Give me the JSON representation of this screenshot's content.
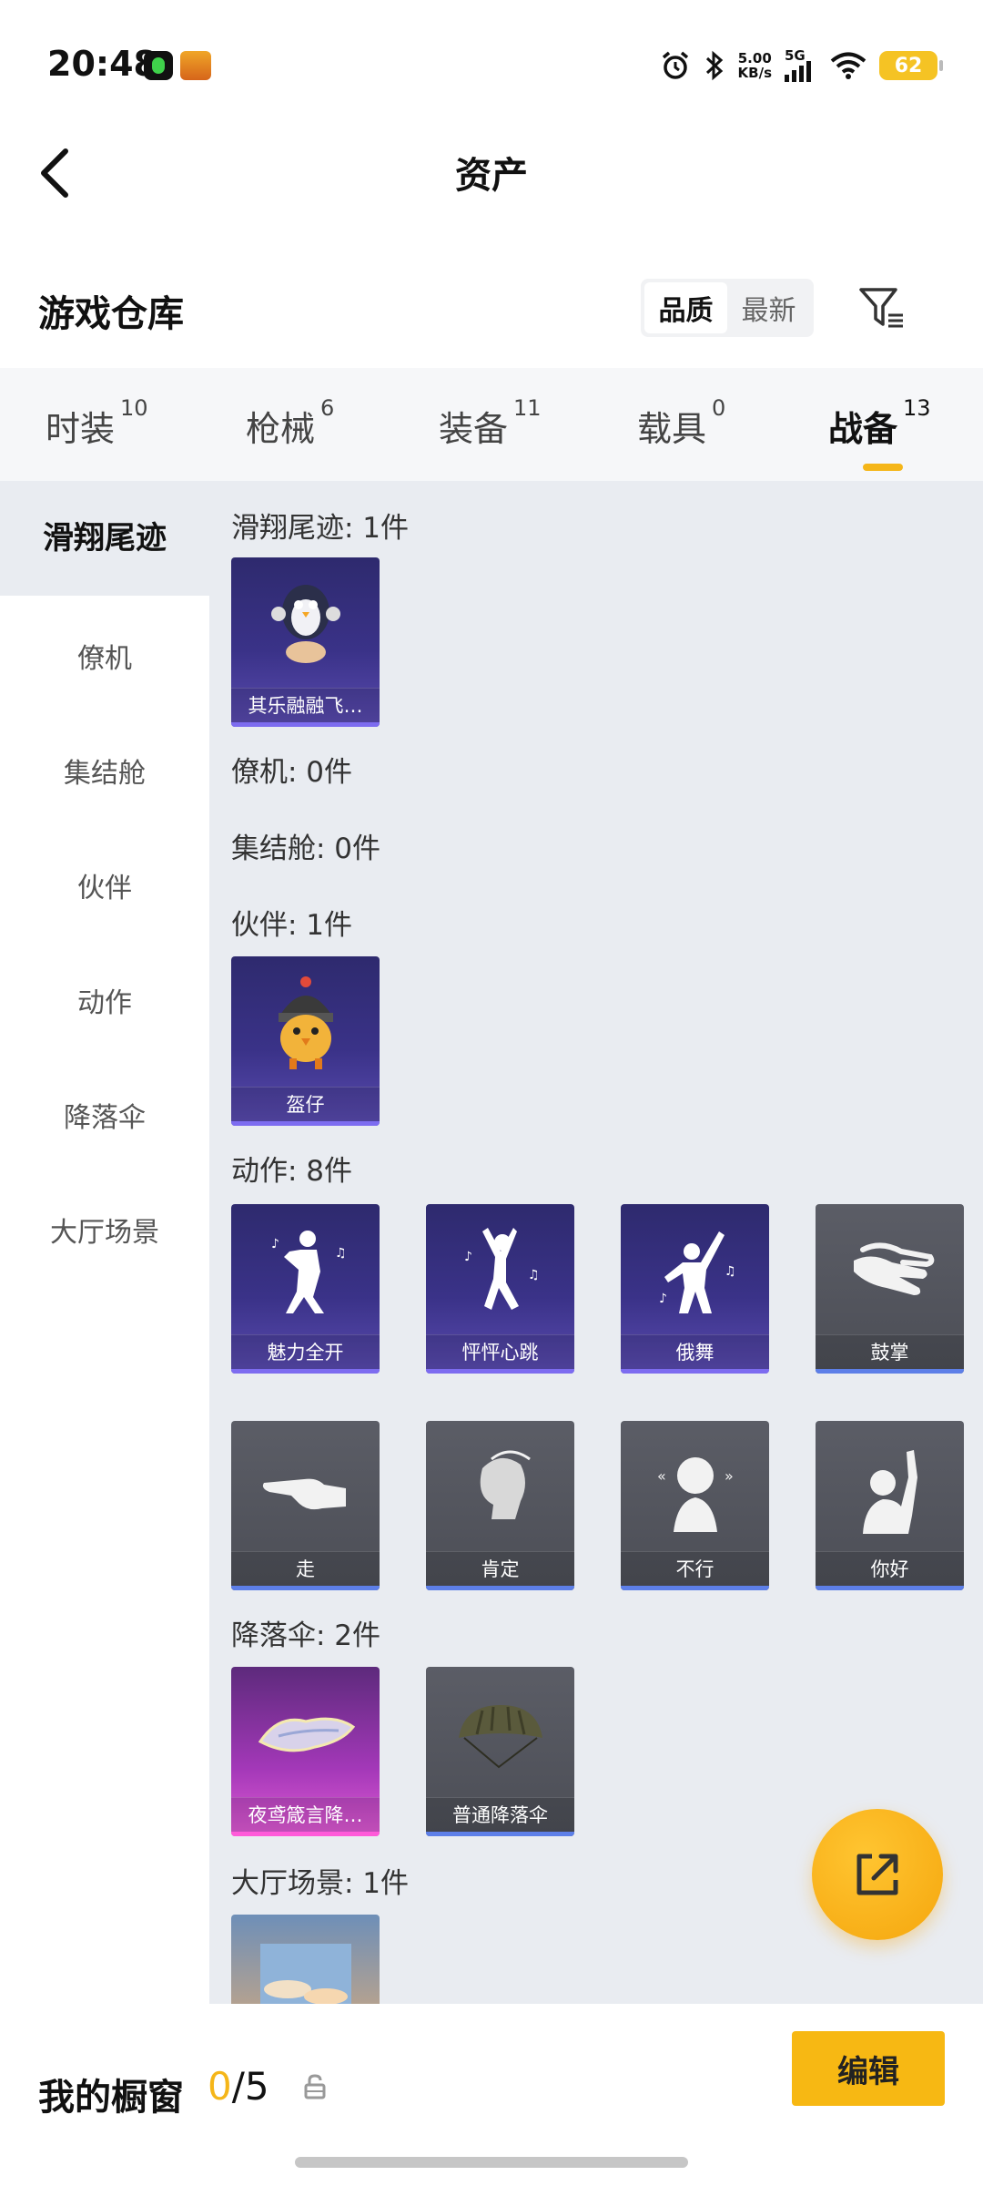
{
  "status_bar": {
    "time": "20:48",
    "net_speed_value": "5.00",
    "net_speed_unit": "KB/s",
    "network": "5G",
    "battery": "62"
  },
  "header": {
    "title": "资产"
  },
  "warehouse": {
    "title": "游戏仓库",
    "sort_options": [
      "品质",
      "最新"
    ],
    "active_sort": "品质"
  },
  "category_tabs": [
    {
      "label": "时装",
      "count": "10"
    },
    {
      "label": "枪械",
      "count": "6"
    },
    {
      "label": "装备",
      "count": "11"
    },
    {
      "label": "载具",
      "count": "0"
    },
    {
      "label": "战备",
      "count": "13"
    }
  ],
  "active_category": "战备",
  "sidebar": {
    "items": [
      "滑翔尾迹",
      "僚机",
      "集结舱",
      "伙伴",
      "动作",
      "降落伞",
      "大厅场景"
    ],
    "active": "滑翔尾迹"
  },
  "sections": {
    "glide_trail": {
      "label": "滑翔尾迹: 1件",
      "items": [
        {
          "name": "其乐融融飞…",
          "icon": "penguin-icon"
        }
      ]
    },
    "wingman": {
      "label": "僚机: 0件"
    },
    "rally_pod": {
      "label": "集结舱: 0件"
    },
    "partner": {
      "label": "伙伴: 1件",
      "items": [
        {
          "name": "盔仔",
          "icon": "helmet-chick-icon"
        }
      ]
    },
    "emote": {
      "label": "动作: 8件",
      "items": [
        {
          "name": "魅力全开",
          "icon": "dance-pose-icon"
        },
        {
          "name": "怦怦心跳",
          "icon": "dance-leap-icon"
        },
        {
          "name": "俄舞",
          "icon": "dance-arm-up-icon"
        },
        {
          "name": "鼓掌",
          "icon": "clap-icon"
        },
        {
          "name": "走",
          "icon": "point-hand-icon"
        },
        {
          "name": "肯定",
          "icon": "nod-head-icon"
        },
        {
          "name": "不行",
          "icon": "shake-head-icon"
        },
        {
          "name": "你好",
          "icon": "wave-icon"
        }
      ]
    },
    "parachute": {
      "label": "降落伞: 2件",
      "items": [
        {
          "name": "夜鸢箴言降…",
          "icon": "glider-parachute-icon"
        },
        {
          "name": "普通降落伞",
          "icon": "parachute-icon"
        }
      ]
    },
    "lobby_scene": {
      "label": "大厅场景: 1件",
      "items": [
        {
          "name": "",
          "icon": "sky-scene-icon"
        }
      ]
    }
  },
  "bottom": {
    "showcase_label": "我的橱窗",
    "showcase_current": "0",
    "showcase_total": "/5",
    "edit_label": "编辑"
  },
  "colors": {
    "accent": "#f5b619",
    "button": "#f7b813",
    "purple_card": "#3a3288",
    "gray_card": "#50525a",
    "pink_card": "#a338b8"
  }
}
